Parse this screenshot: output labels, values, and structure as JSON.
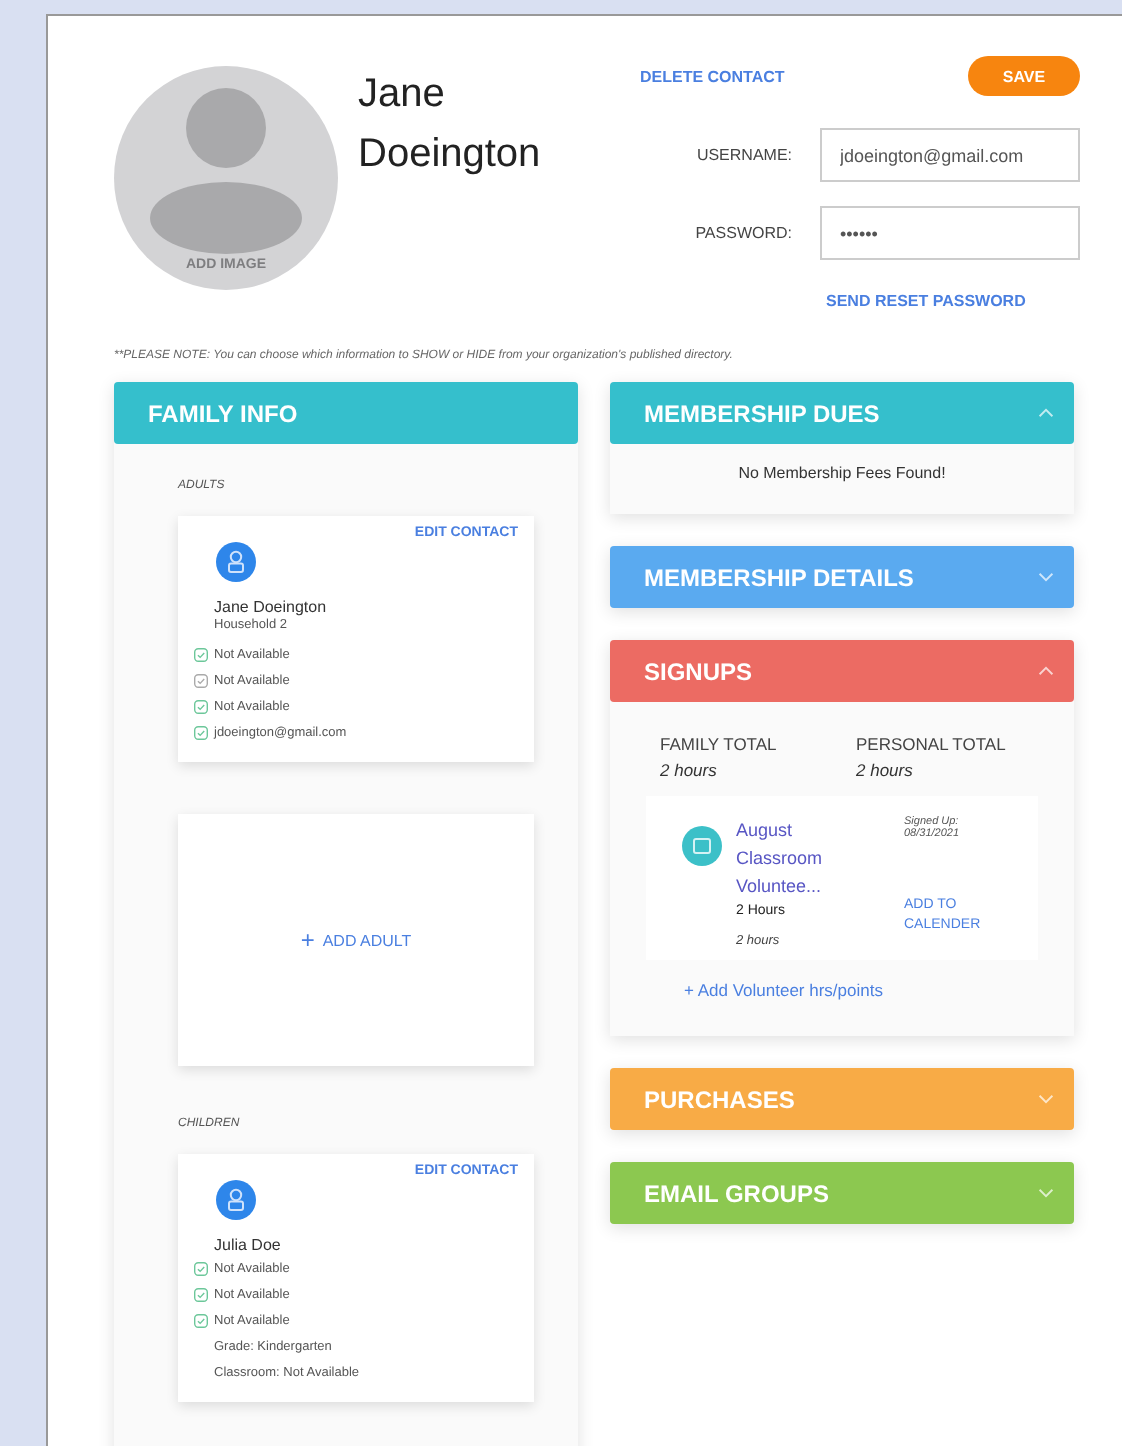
{
  "profile": {
    "first_name": "Jane",
    "last_name": "Doeington",
    "add_image": "ADD IMAGE",
    "delete_link": "DELETE CONTACT",
    "save_button": "SAVE",
    "username": {
      "label": "USERNAME:",
      "value": "jdoeington@gmail.com"
    },
    "password": {
      "label": "PASSWORD:",
      "value": "••••••"
    },
    "reset_link": "SEND RESET PASSWORD"
  },
  "note": "**PLEASE NOTE: You can choose which information to SHOW or HIDE from your organization's published directory.",
  "family_info": {
    "title": "FAMILY INFO",
    "groups": [
      {
        "label": "ADULTS",
        "add_label": "ADD ADULT",
        "add_icon": "+",
        "contacts": [
          {
            "name": "Jane Doeington",
            "edit_link": "EDIT CONTACT",
            "household": "Household 2",
            "fields": [
              {
                "text": "Not Available",
                "shown": true
              },
              {
                "text": "Not Available",
                "shown": false
              },
              {
                "text": "Not Available",
                "shown": true
              },
              {
                "text": "jdoeington@gmail.com",
                "shown": true
              }
            ]
          }
        ]
      },
      {
        "label": "CHILDREN",
        "contacts": [
          {
            "name": "Julia Doe",
            "edit_link": "EDIT CONTACT",
            "fields": [
              {
                "text": "Not Available",
                "shown": true
              },
              {
                "text": "Not Available",
                "shown": true
              },
              {
                "text": "Not Available",
                "shown": true
              }
            ],
            "details": [
              "Grade: Kindergarten",
              "Classroom: Not Available"
            ]
          }
        ]
      }
    ]
  },
  "sections": [
    {
      "kind": "message",
      "title": "MEMBERSHIP DUES",
      "color": "#35bfcc",
      "expanded": true,
      "message": "No Membership Fees Found!"
    },
    {
      "title": "MEMBERSHIP DETAILS",
      "color": "#5aaaf0",
      "expanded": false
    },
    {
      "kind": "signups",
      "title": "SIGNUPS",
      "color": "#ec6b63",
      "expanded": true,
      "totals": [
        {
          "label": "FAMILY TOTAL",
          "value": "2 hours"
        },
        {
          "label": "PERSONAL TOTAL",
          "value": "2 hours"
        }
      ],
      "items": [
        {
          "title": "August Classroom Voluntee...",
          "hours": "2 Hours",
          "hours_done": "2 hours",
          "signed_label": "Signed Up:",
          "signed_date": "08/31/2021",
          "calendar_link": "ADD TO CALENDER"
        }
      ],
      "add_link": "+ Add Volunteer hrs/points"
    },
    {
      "title": "PURCHASES",
      "color": "#f8ab46",
      "expanded": false
    },
    {
      "title": "EMAIL GROUPS",
      "color": "#8cc850",
      "expanded": false
    }
  ]
}
